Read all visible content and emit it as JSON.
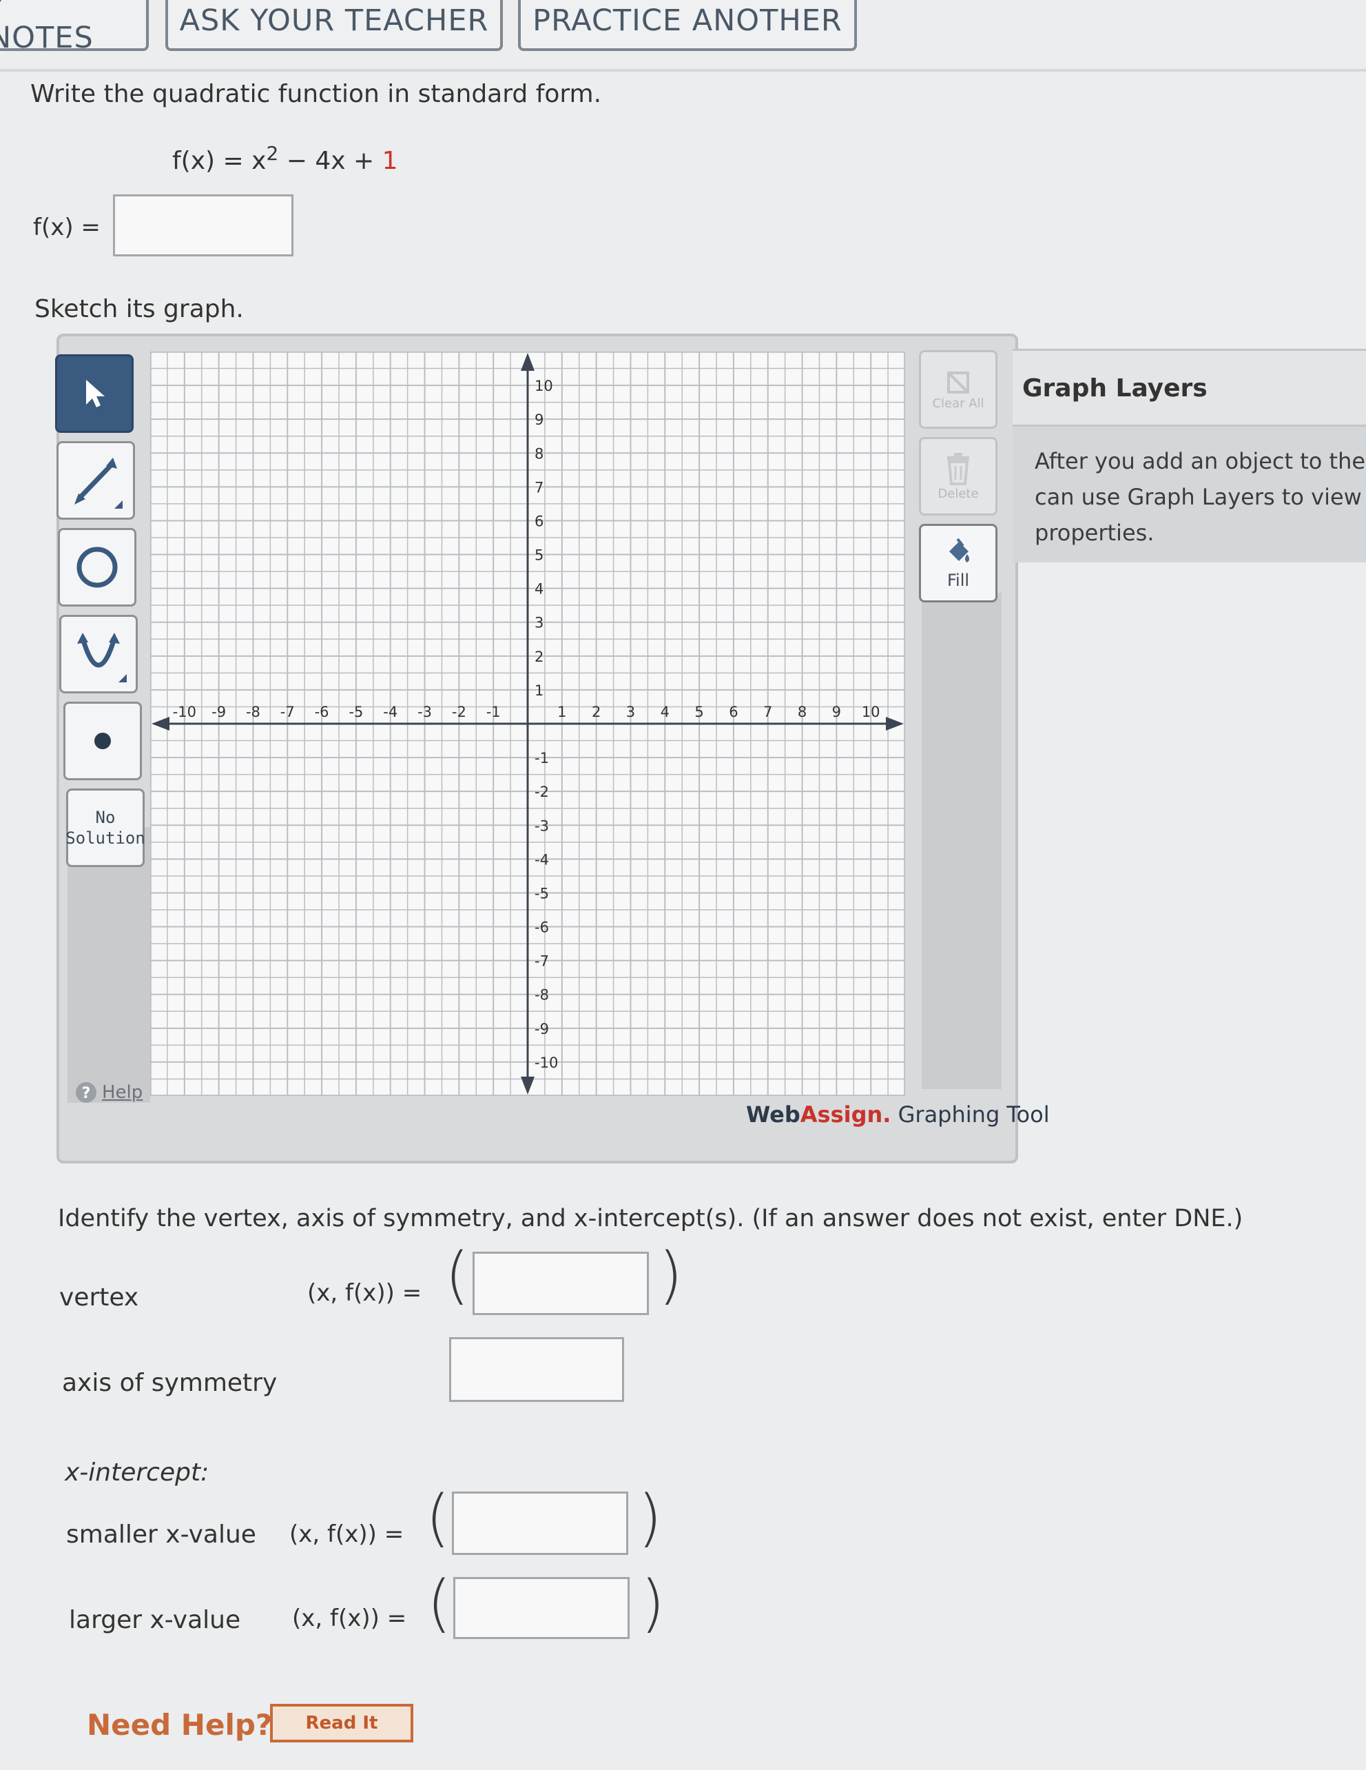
{
  "toolbar": {
    "my_notes_label": "Y NOTES",
    "ask_teacher_label": "ASK YOUR TEACHER",
    "practice_label": "PRACTICE ANOTHER"
  },
  "question": {
    "prompt": "Write the quadratic function in standard form.",
    "given_lhs": "f(x) = x",
    "given_exp": "2",
    "given_mid": " − 4x + ",
    "given_const": "1",
    "answer_label": "f(x) =",
    "answer_value": "",
    "sketch_prompt": "Sketch its graph."
  },
  "graph_tool": {
    "tools": [
      {
        "name": "pointer-tool",
        "icon": "arrow-cursor-icon"
      },
      {
        "name": "line-tool",
        "icon": "line-segment-icon"
      },
      {
        "name": "circle-tool",
        "icon": "circle-icon"
      },
      {
        "name": "parabola-tool",
        "icon": "parabola-icon"
      },
      {
        "name": "point-tool",
        "icon": "point-icon"
      }
    ],
    "no_solution_line1": "No",
    "no_solution_line2": "Solution",
    "help_label": "Help",
    "clear_all_label": "Clear All",
    "delete_label": "Delete",
    "fill_label": "Fill",
    "brand_web": "Web",
    "brand_assign": "Assign.",
    "brand_tool": " Graphing Tool",
    "x_ticks": [
      "-10",
      "-9",
      "-8",
      "-7",
      "-6",
      "-5",
      "-4",
      "-3",
      "-2",
      "-1",
      "1",
      "2",
      "3",
      "4",
      "5",
      "6",
      "7",
      "8",
      "9",
      "10"
    ],
    "y_ticks": [
      "10",
      "9",
      "8",
      "7",
      "6",
      "5",
      "4",
      "3",
      "2",
      "1",
      "-1",
      "-2",
      "-3",
      "-4",
      "-5",
      "-6",
      "-7",
      "-8",
      "-9",
      "-10"
    ],
    "xlim": [
      -11,
      11
    ],
    "ylim": [
      -11,
      11
    ],
    "grid": true
  },
  "layers": {
    "title": "Graph Layers",
    "line1": "After you add an object to the gra",
    "line2": "can use Graph Layers to view anc",
    "line3": "properties."
  },
  "identify": {
    "prompt": "Identify the vertex, axis of symmetry, and x-intercept(s). (If an answer does not exist, enter DNE.)",
    "vertex_label": "vertex",
    "vertex_expr": "(x, f(x))  =",
    "vertex_value": "",
    "axis_label": "axis of symmetry",
    "axis_value": "",
    "xint_label": "x-intercept:",
    "smaller_label": "smaller x-value",
    "smaller_expr": "(x, f(x))  =",
    "smaller_value": "",
    "larger_label": "larger x-value",
    "larger_expr": "(x, f(x))  =",
    "larger_value": ""
  },
  "help": {
    "need_help": "Need Help?",
    "read_it": "Read It"
  }
}
